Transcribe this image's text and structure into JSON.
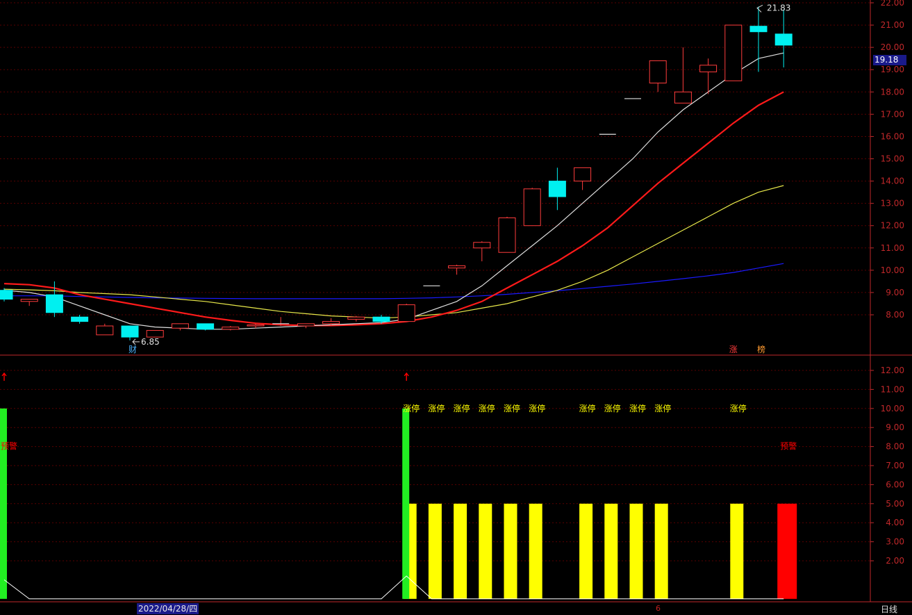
{
  "app": {
    "period_label": "日线",
    "cursor_date": "2022/04/28/四",
    "marker_6": "6"
  },
  "price_tag": {
    "value": "19.18"
  },
  "annotations": {
    "high_label": "21.83",
    "low_label": "6.85",
    "cai_tag": "财",
    "zhang_tag": "涨",
    "bang_tag": "榜",
    "limit_up_text": "涨停",
    "warning_text": "预警"
  },
  "colors": {
    "up": "#ff3c3c",
    "down": "#00f0f0",
    "ma_white": "#e0e0e0",
    "ma_red": "#ff1a1a",
    "ma_yellow": "#e8e84a",
    "ma_blue": "#1a1aff",
    "grid": "#5a0000",
    "axis": "#c0282a",
    "bar_yellow": "#ffff00",
    "bar_green": "#22ee22",
    "bar_red": "#ff0000"
  },
  "chart_data": [
    {
      "type": "candlestick",
      "title": "",
      "y_ticks": [
        "8.00",
        "9.00",
        "10.00",
        "11.00",
        "12.00",
        "13.00",
        "14.00",
        "15.00",
        "16.00",
        "17.00",
        "18.00",
        "19.00",
        "20.00",
        "21.00",
        "22.00"
      ],
      "ylim": [
        6.0,
        22.0
      ],
      "grid": true,
      "candles": [
        {
          "o": 9.1,
          "h": 9.2,
          "l": 8.6,
          "c": 8.7
        },
        {
          "o": 8.6,
          "h": 8.7,
          "l": 8.4,
          "c": 8.7
        },
        {
          "o": 8.9,
          "h": 9.5,
          "l": 7.9,
          "c": 8.1
        },
        {
          "o": 7.9,
          "h": 8.0,
          "l": 7.6,
          "c": 7.7
        },
        {
          "o": 7.1,
          "h": 7.6,
          "l": 7.1,
          "c": 7.5
        },
        {
          "o": 7.5,
          "h": 7.5,
          "l": 6.85,
          "c": 7.0
        },
        {
          "o": 7.0,
          "h": 7.3,
          "l": 7.0,
          "c": 7.3
        },
        {
          "o": 7.4,
          "h": 7.6,
          "l": 7.3,
          "c": 7.6
        },
        {
          "o": 7.6,
          "h": 7.6,
          "l": 7.3,
          "c": 7.35
        },
        {
          "o": 7.35,
          "h": 7.5,
          "l": 7.3,
          "c": 7.45
        },
        {
          "o": 7.5,
          "h": 7.6,
          "l": 7.4,
          "c": 7.55
        },
        {
          "o": 7.6,
          "h": 7.9,
          "l": 7.5,
          "c": 7.6
        },
        {
          "o": 7.5,
          "h": 7.6,
          "l": 7.4,
          "c": 7.6
        },
        {
          "o": 7.6,
          "h": 7.85,
          "l": 7.5,
          "c": 7.7
        },
        {
          "o": 7.8,
          "h": 7.95,
          "l": 7.7,
          "c": 7.9
        },
        {
          "o": 7.9,
          "h": 8.0,
          "l": 7.6,
          "c": 7.7
        },
        {
          "o": 7.7,
          "h": 8.5,
          "l": 7.7,
          "c": 8.45
        },
        {
          "o": 9.3,
          "h": 9.3,
          "l": 9.3,
          "c": 9.3
        },
        {
          "o": 10.1,
          "h": 10.25,
          "l": 9.8,
          "c": 10.2
        },
        {
          "o": 11.0,
          "h": 11.3,
          "l": 10.4,
          "c": 11.25
        },
        {
          "o": 10.8,
          "h": 12.4,
          "l": 10.8,
          "c": 12.35
        },
        {
          "o": 12.0,
          "h": 13.7,
          "l": 12.0,
          "c": 13.65
        },
        {
          "o": 14.0,
          "h": 14.6,
          "l": 12.7,
          "c": 13.3
        },
        {
          "o": 14.0,
          "h": 14.6,
          "l": 13.6,
          "c": 14.6
        },
        {
          "o": 16.1,
          "h": 16.1,
          "l": 16.1,
          "c": 16.1
        },
        {
          "o": 17.7,
          "h": 17.7,
          "l": 17.7,
          "c": 17.7
        },
        {
          "o": 18.4,
          "h": 19.4,
          "l": 18.0,
          "c": 19.4
        },
        {
          "o": 17.5,
          "h": 20.0,
          "l": 17.5,
          "c": 18.0
        },
        {
          "o": 18.9,
          "h": 19.5,
          "l": 17.9,
          "c": 19.2
        },
        {
          "o": 18.5,
          "h": 21.0,
          "l": 18.5,
          "c": 21.0
        },
        {
          "o": 20.95,
          "h": 21.83,
          "l": 18.9,
          "c": 20.7
        },
        {
          "o": 20.6,
          "h": 21.7,
          "l": 19.1,
          "c": 20.1
        }
      ],
      "ma_white": [
        9.1,
        9.0,
        8.8,
        8.4,
        8.0,
        7.6,
        7.45,
        7.4,
        7.35,
        7.35,
        7.4,
        7.45,
        7.5,
        7.55,
        7.6,
        7.65,
        7.8,
        8.2,
        8.6,
        9.3,
        10.2,
        11.1,
        12.0,
        13.0,
        14.0,
        15.0,
        16.2,
        17.2,
        18.0,
        18.8,
        19.5,
        19.75
      ],
      "ma_red": [
        9.4,
        9.35,
        9.2,
        8.9,
        8.7,
        8.5,
        8.3,
        8.1,
        7.9,
        7.75,
        7.62,
        7.55,
        7.52,
        7.52,
        7.55,
        7.6,
        7.7,
        7.9,
        8.2,
        8.6,
        9.2,
        9.8,
        10.4,
        11.1,
        11.9,
        12.9,
        13.9,
        14.8,
        15.7,
        16.6,
        17.4,
        18.0
      ],
      "ma_yellow": [
        9.15,
        9.12,
        9.08,
        9.0,
        8.95,
        8.9,
        8.8,
        8.7,
        8.6,
        8.45,
        8.3,
        8.15,
        8.05,
        7.95,
        7.9,
        7.85,
        7.9,
        8.0,
        8.1,
        8.3,
        8.5,
        8.8,
        9.1,
        9.5,
        10.0,
        10.6,
        11.2,
        11.8,
        12.4,
        13.0,
        13.5,
        13.8
      ],
      "ma_blue": [
        8.85,
        8.85,
        8.85,
        8.82,
        8.8,
        8.78,
        8.76,
        8.75,
        8.74,
        8.73,
        8.72,
        8.72,
        8.72,
        8.72,
        8.72,
        8.72,
        8.74,
        8.76,
        8.8,
        8.85,
        8.92,
        9.0,
        9.08,
        9.18,
        9.28,
        9.38,
        9.5,
        9.62,
        9.75,
        9.9,
        10.1,
        10.3
      ]
    },
    {
      "type": "bar",
      "title": "",
      "y_ticks": [
        "2.00",
        "3.00",
        "4.00",
        "5.00",
        "6.00",
        "7.00",
        "8.00",
        "9.00",
        "10.00",
        "11.00",
        "12.00"
      ],
      "ylim": [
        0,
        12.4
      ],
      "grid": true,
      "values": [
        0,
        0,
        0,
        0,
        0,
        0,
        0,
        0,
        0,
        0,
        0,
        0,
        0,
        0,
        0,
        0,
        5,
        5,
        5,
        5,
        5,
        5,
        0,
        5,
        5,
        5,
        5,
        0,
        0,
        5,
        0,
        5
      ],
      "colors": [
        "r",
        "",
        "",
        "",
        "",
        "",
        "",
        "",
        "",
        "",
        "",
        "",
        "",
        "",
        "",
        "",
        "y",
        "y",
        "y",
        "y",
        "y",
        "y",
        "",
        "y",
        "y",
        "y",
        "y",
        "",
        "",
        "y",
        "",
        "r"
      ],
      "green_bars": [
        {
          "index": 0,
          "value": 10.0
        },
        {
          "index": 16,
          "value": 10.0
        }
      ],
      "limit_up_flags": [
        16,
        17,
        18,
        19,
        20,
        21,
        23,
        24,
        25,
        26,
        29
      ],
      "warning_flags": [
        0,
        31
      ],
      "arrow_flags": [
        0,
        16
      ],
      "line_values": [
        1.0,
        0,
        0,
        0,
        0,
        0,
        0,
        0,
        0,
        0,
        0,
        0,
        0,
        0,
        0,
        0,
        1.2,
        0,
        0,
        0,
        0,
        0,
        0,
        0,
        0,
        0,
        0,
        0,
        0,
        0,
        0,
        0
      ]
    }
  ]
}
